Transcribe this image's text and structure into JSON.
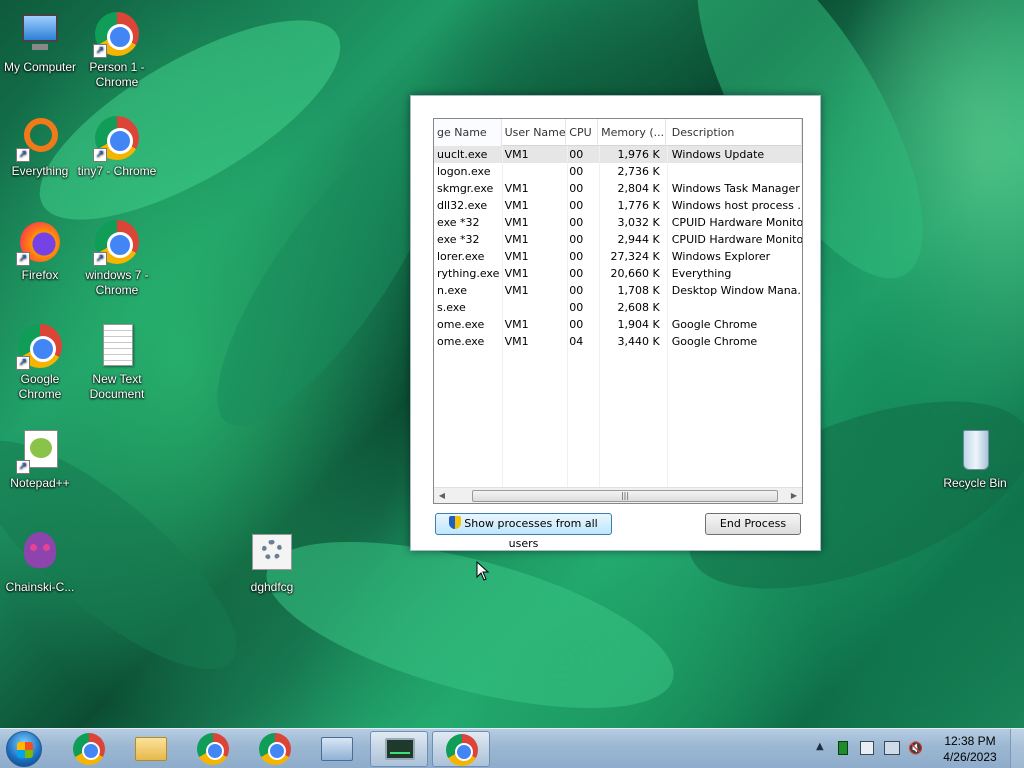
{
  "desktop": {
    "icons": [
      {
        "label": "My Computer",
        "icon": "my-computer-icon"
      },
      {
        "label": "Person 1 - Chrome",
        "icon": "chrome-icon"
      },
      {
        "label": "Everything",
        "icon": "everything-icon"
      },
      {
        "label": "tiny7 - Chrome",
        "icon": "chrome-icon"
      },
      {
        "label": "Firefox",
        "icon": "firefox-icon"
      },
      {
        "label": "windows 7 - Chrome",
        "icon": "chrome-icon"
      },
      {
        "label": "Google Chrome",
        "icon": "chrome-icon"
      },
      {
        "label": "New Text Document",
        "icon": "text-document-icon"
      },
      {
        "label": "Notepad++",
        "icon": "notepadpp-icon"
      },
      {
        "label": "Chainski-C...",
        "icon": "skull-icon"
      },
      {
        "label": "dghdfcg",
        "icon": "settings-file-icon"
      },
      {
        "label": "Recycle Bin",
        "icon": "recycle-bin-icon"
      }
    ]
  },
  "task_manager": {
    "columns": [
      "ge Name",
      "User Name",
      "CPU",
      "Memory (...",
      "Description"
    ],
    "rows": [
      {
        "name": "uuclt.exe",
        "user": "VM1",
        "cpu": "00",
        "memory": "1,976 K",
        "description": "Windows Update"
      },
      {
        "name": "logon.exe",
        "user": "",
        "cpu": "00",
        "memory": "2,736 K",
        "description": ""
      },
      {
        "name": "skmgr.exe",
        "user": "VM1",
        "cpu": "00",
        "memory": "2,804 K",
        "description": "Windows Task Manager"
      },
      {
        "name": "dll32.exe",
        "user": "VM1",
        "cpu": "00",
        "memory": "1,776 K",
        "description": "Windows host process ..."
      },
      {
        "name": "exe *32",
        "user": "VM1",
        "cpu": "00",
        "memory": "3,032 K",
        "description": "CPUID Hardware Monitor"
      },
      {
        "name": "exe *32",
        "user": "VM1",
        "cpu": "00",
        "memory": "2,944 K",
        "description": "CPUID Hardware Monitor"
      },
      {
        "name": "lorer.exe",
        "user": "VM1",
        "cpu": "00",
        "memory": "27,324 K",
        "description": "Windows Explorer"
      },
      {
        "name": "rything.exe",
        "user": "VM1",
        "cpu": "00",
        "memory": "20,660 K",
        "description": "Everything"
      },
      {
        "name": "n.exe",
        "user": "VM1",
        "cpu": "00",
        "memory": "1,708 K",
        "description": "Desktop Window Mana..."
      },
      {
        "name": "s.exe",
        "user": "",
        "cpu": "00",
        "memory": "2,608 K",
        "description": ""
      },
      {
        "name": "ome.exe",
        "user": "VM1",
        "cpu": "00",
        "memory": "1,904 K",
        "description": "Google Chrome"
      },
      {
        "name": "ome.exe",
        "user": "VM1",
        "cpu": "04",
        "memory": "3,440 K",
        "description": "Google Chrome"
      }
    ],
    "show_all_label": "Show processes from all users",
    "end_process_label": "End Process"
  },
  "taskbar": {
    "items": [
      "chrome",
      "file-explorer",
      "chrome-profile",
      "chrome-profile",
      "keyboard-app",
      "task-manager",
      "chrome"
    ],
    "time": "12:38 PM",
    "date": "4/26/2023"
  }
}
